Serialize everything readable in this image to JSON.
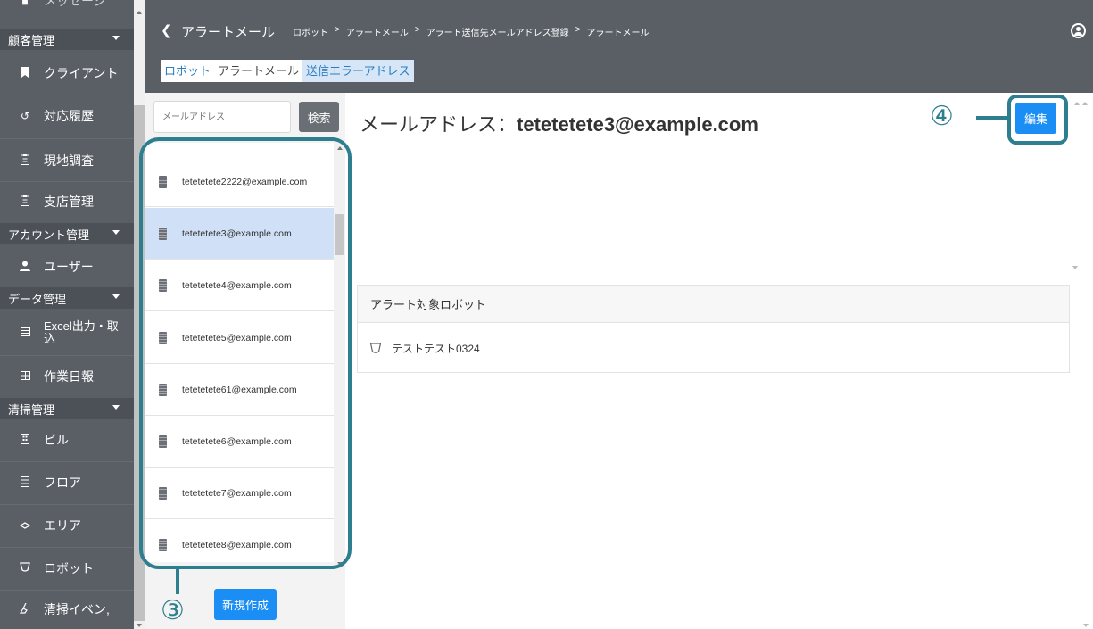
{
  "sidebar": {
    "top_partial_label": "メッセージ",
    "groups": [
      {
        "label": "顧客管理"
      },
      {
        "label": "アカウント管理"
      },
      {
        "label": "データ管理"
      },
      {
        "label": "清掃管理"
      }
    ],
    "items": [
      {
        "label": "クライアント",
        "icon": "bookmark-icon"
      },
      {
        "label": "対応履歴",
        "icon": "history-icon"
      },
      {
        "label": "現地調査",
        "icon": "clipboard-icon"
      },
      {
        "label": "支店管理",
        "icon": "clipboard-icon"
      },
      {
        "label": "ユーザー",
        "icon": "user-icon"
      },
      {
        "label": "Excel出力・取込",
        "icon": "table-icon"
      },
      {
        "label": "作業日報",
        "icon": "grid-icon"
      },
      {
        "label": "ビル",
        "icon": "building-icon"
      },
      {
        "label": "フロア",
        "icon": "floor-icon"
      },
      {
        "label": "エリア",
        "icon": "area-icon"
      },
      {
        "label": "ロボット",
        "icon": "robot-icon"
      },
      {
        "label": "清掃イベン,",
        "icon": "broom-icon"
      }
    ]
  },
  "header": {
    "title": "アラートメール",
    "breadcrumb": [
      "ロボット",
      "アラートメール",
      "アラート送信先メールアドレス登録",
      "アラートメール"
    ],
    "tabs": [
      {
        "label": "ロボット"
      },
      {
        "label": "アラートメール"
      },
      {
        "label": "送信エラーアドレス"
      }
    ]
  },
  "search": {
    "placeholder": "メールアドレス",
    "button_label": "検索"
  },
  "list": {
    "items": [
      "tetetetete2222@example.com",
      "tetetetete3@example.com",
      "tetetetete4@example.com",
      "tetetetete5@example.com",
      "tetetetete61@example.com",
      "tetetetete6@example.com",
      "tetetetete7@example.com",
      "tetetetete8@example.com"
    ],
    "selected_index": 1,
    "new_button_label": "新規作成"
  },
  "detail": {
    "title_label": "メールアドレス：",
    "title_value": "tetetetete3@example.com",
    "edit_button_label": "編集",
    "card_header": "アラート対象ロボット",
    "robot_name": "テストテスト0324"
  },
  "annotations": {
    "list_callout": "③",
    "edit_callout": "④",
    "color": "#2d7e8e"
  },
  "colors": {
    "sidebar_bg": "#5a5f66",
    "primary_button": "#1a8ef5",
    "selected_row": "#cfe0f7"
  }
}
